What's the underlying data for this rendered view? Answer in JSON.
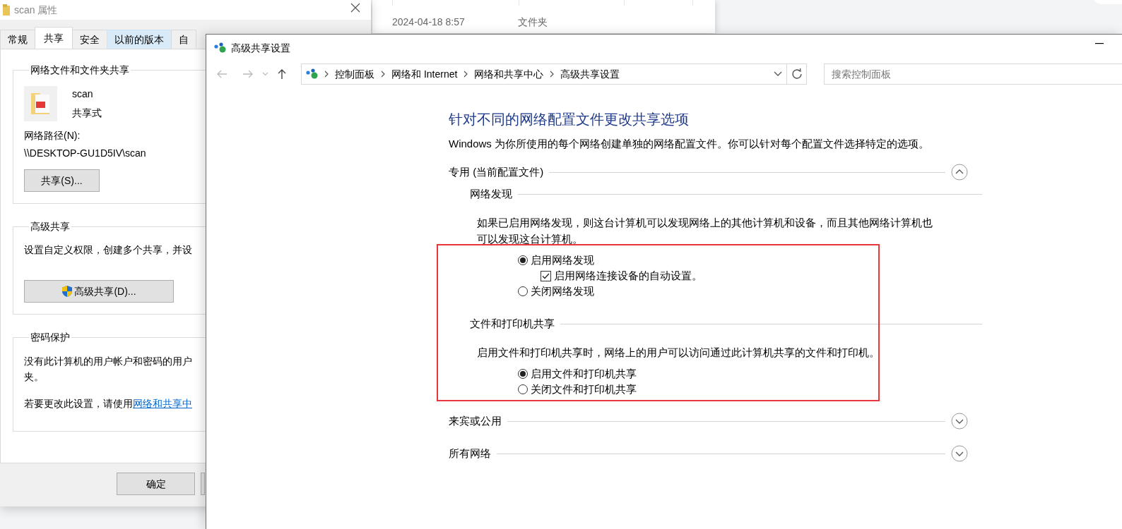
{
  "properties_dialog": {
    "title": "scan 属性",
    "tabs": [
      {
        "label": "常规",
        "selected": false,
        "hovered": false
      },
      {
        "label": "共享",
        "selected": true,
        "hovered": false
      },
      {
        "label": "安全",
        "selected": false,
        "hovered": false
      },
      {
        "label": "以前的版本",
        "selected": false,
        "hovered": true
      },
      {
        "label": "自",
        "selected": false,
        "hovered": false
      }
    ],
    "sharing_group": {
      "title": "网络文件和文件夹共享",
      "name": "scan",
      "state": "共享式",
      "path_label": "网络路径(N):",
      "path": "\\\\DESKTOP-GU1D5IV\\scan",
      "button": "共享(S)..."
    },
    "advanced_group": {
      "title": "高级共享",
      "description": "设置自定义权限，创建多个共享，并设",
      "button": "高级共享(D)..."
    },
    "password_group": {
      "title": "密码保护",
      "lines": [
        "没有此计算机的用户帐户和密码的用户",
        "夹。"
      ],
      "note": "若要更改此设置，请使用",
      "link": "网络和共享中"
    },
    "buttons": [
      "确定"
    ]
  },
  "explorer_row": {
    "date": "2024-04-18 8:57",
    "type": "文件夹"
  },
  "window": {
    "title": "高级共享设置"
  },
  "address_bar": {
    "breadcrumbs": [
      "控制面板",
      "网络和 Internet",
      "网络和共享中心",
      "高级共享设置"
    ]
  },
  "search": {
    "placeholder": "搜索控制面板"
  },
  "heading": "针对不同的网络配置文件更改共享选项",
  "intro": "Windows 为你所使用的每个网络创建单独的网络配置文件。你可以针对每个配置文件选择特定的选项。",
  "profiles": [
    {
      "title": "专用 (当前配置文件)",
      "expanded": true,
      "sections": [
        {
          "title": "网络发现",
          "description": "如果已启用网络发现，则这台计算机可以发现网络上的其他计算机和设备，而且其他网络计算机也可以发现这台计算机。",
          "options": [
            {
              "kind": "radio",
              "label": "启用网络发现",
              "selected": true,
              "children": [
                {
                  "kind": "checkbox",
                  "label": "启用网络连接设备的自动设置。",
                  "checked": true
                }
              ]
            },
            {
              "kind": "radio",
              "label": "关闭网络发现",
              "selected": false
            }
          ]
        },
        {
          "title": "文件和打印机共享",
          "description": "启用文件和打印机共享时，网络上的用户可以访问通过此计算机共享的文件和打印机。",
          "options": [
            {
              "kind": "radio",
              "label": "启用文件和打印机共享",
              "selected": true
            },
            {
              "kind": "radio",
              "label": "关闭文件和打印机共享",
              "selected": false
            }
          ]
        }
      ]
    },
    {
      "title": "来宾或公用",
      "expanded": false
    },
    {
      "title": "所有网络",
      "expanded": false
    }
  ]
}
